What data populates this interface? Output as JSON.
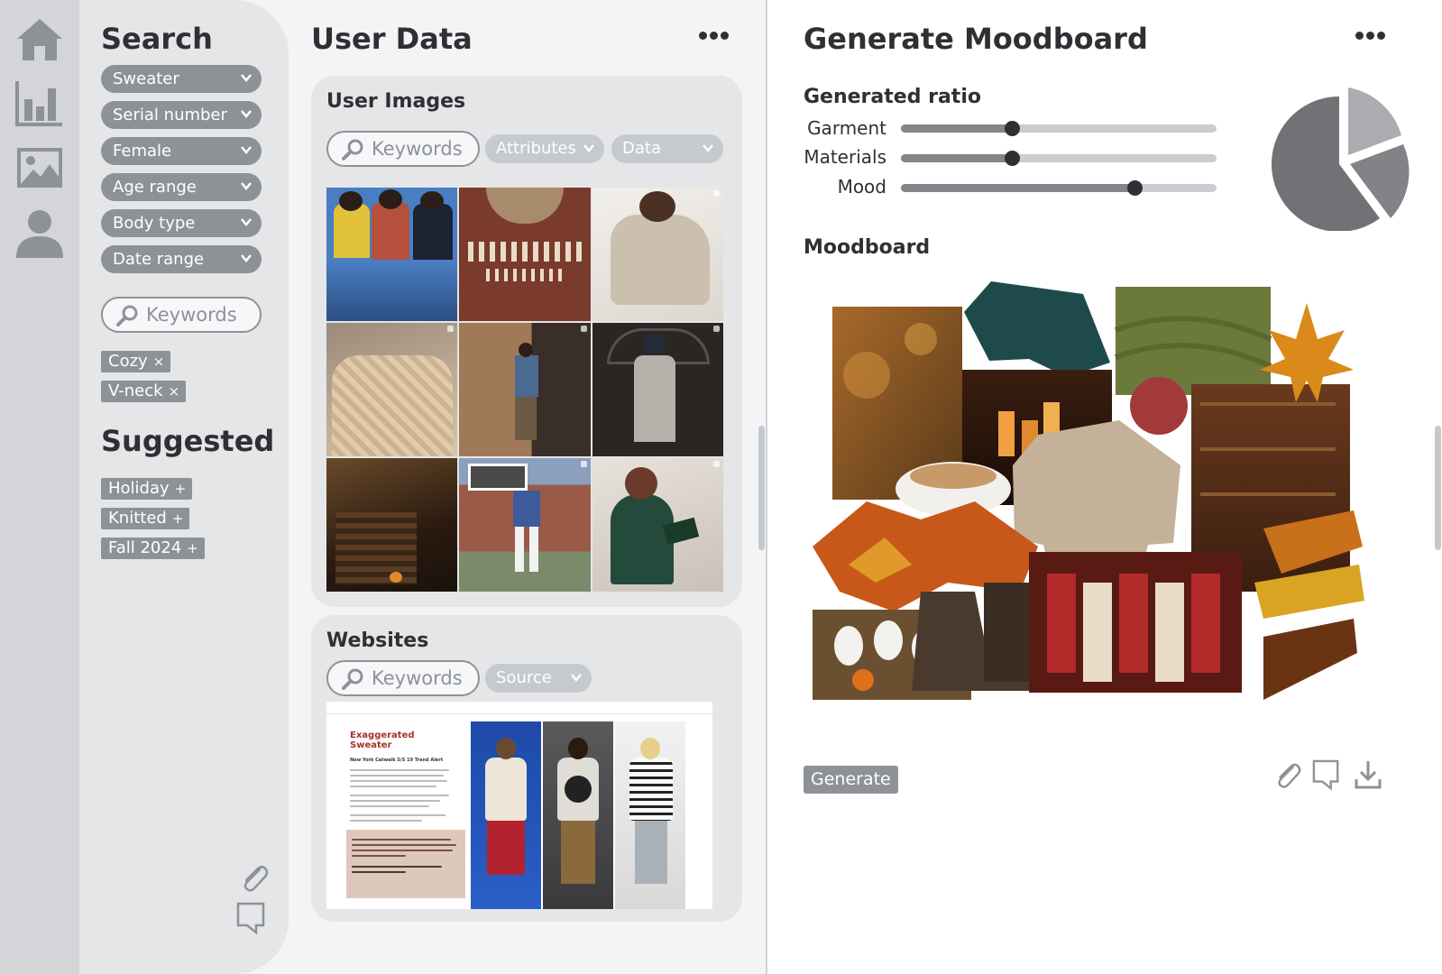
{
  "nav": {
    "icons": [
      "home-icon",
      "bar-chart-icon",
      "image-icon",
      "user-icon"
    ]
  },
  "search": {
    "title": "Search",
    "filters": [
      {
        "label": "Sweater"
      },
      {
        "label": "Serial number"
      },
      {
        "label": "Female"
      },
      {
        "label": "Age range"
      },
      {
        "label": "Body type"
      },
      {
        "label": "Date range"
      }
    ],
    "keyword_placeholder": "Keywords",
    "active_tags": [
      {
        "label": "Cozy",
        "action": "×"
      },
      {
        "label": "V-neck",
        "action": "×"
      }
    ]
  },
  "suggested": {
    "title": "Suggested",
    "tags": [
      {
        "label": "Holiday",
        "action": "+"
      },
      {
        "label": "Knitted",
        "action": "+"
      },
      {
        "label": "Fall 2024",
        "action": "+"
      }
    ]
  },
  "user_data": {
    "title": "User Data",
    "user_images": {
      "title": "User Images",
      "keyword_placeholder": "Keywords",
      "attributes_label": "Attributes",
      "data_label": "Data"
    },
    "websites": {
      "title": "Websites",
      "keyword_placeholder": "Keywords",
      "source_label": "Source",
      "article_title": "Exaggerated Sweater",
      "article_subtitle": "New York Catwalk S/S 19 Trend Alert"
    }
  },
  "moodboard_panel": {
    "title": "Generate Moodboard",
    "ratio_title": "Generated ratio",
    "sliders": [
      {
        "label": "Garment",
        "value": 0.35
      },
      {
        "label": "Materials",
        "value": 0.35
      },
      {
        "label": "Mood",
        "value": 0.74
      }
    ],
    "section_title": "Moodboard",
    "generate_label": "Generate"
  },
  "colors": {
    "chip_bg": "#8e9297",
    "rail_bg": "#d3d5d8",
    "panel_bg": "#e4e6e8",
    "pie_dark": "#707275",
    "pie_mid": "#818386",
    "pie_light": "#aaacaf"
  }
}
